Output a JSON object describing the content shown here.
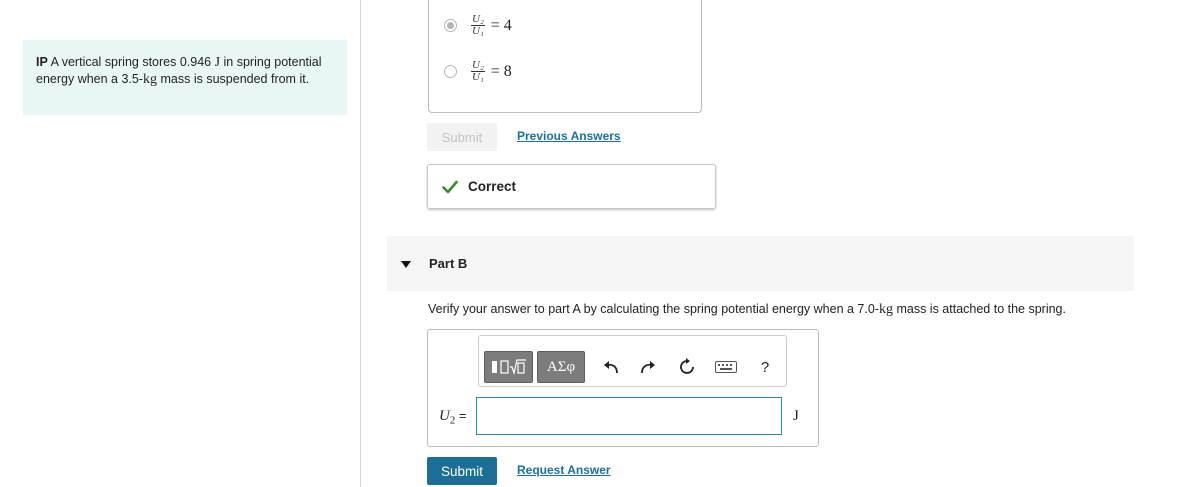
{
  "problem": {
    "prefix": "IP",
    "text_1": "A vertical spring stores 0.946",
    "unit_1": "J",
    "text_2": "in spring potential energy when a 3.5-",
    "unit_2": "kg",
    "text_3": "mass is suspended from it."
  },
  "part_a": {
    "choices": [
      {
        "num": "U₂",
        "den": "U₁",
        "value": "= 4",
        "selected": true
      },
      {
        "num": "U₂",
        "den": "U₁",
        "value": "= 8",
        "selected": false
      }
    ],
    "submit_label": "Submit",
    "previous_answers_label": "Previous Answers",
    "feedback": "Correct",
    "feedback_color": "#3a8a2c"
  },
  "part_b": {
    "title": "Part B",
    "question_1": "Verify your answer to part A by calculating the spring potential energy when a 7.0-",
    "question_unit": "kg",
    "question_2": "mass is attached to the spring.",
    "toolbar": {
      "templates_icon": "templates-icon",
      "greek_label": "ΑΣφ",
      "undo_icon": "undo-icon",
      "redo_icon": "redo-icon",
      "reset_icon": "reset-icon",
      "keyboard_icon": "keyboard-icon",
      "help_label": "?"
    },
    "answer_label_var": "U",
    "answer_label_sub": "2",
    "answer_label_eq": "=",
    "answer_value": "",
    "unit": "J",
    "submit_label": "Submit",
    "request_answer_label": "Request Answer",
    "accent_color": "#1b6f97"
  }
}
